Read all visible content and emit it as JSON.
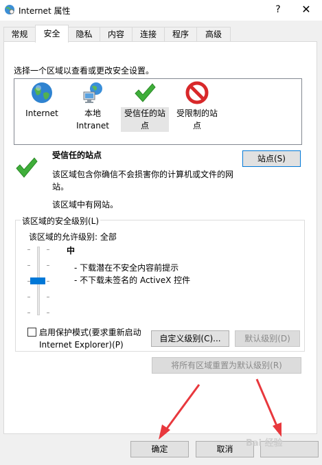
{
  "window": {
    "title": "Internet 属性",
    "help": "?",
    "close": "✕"
  },
  "tabs": [
    {
      "label": "常规"
    },
    {
      "label": "安全"
    },
    {
      "label": "隐私"
    },
    {
      "label": "内容"
    },
    {
      "label": "连接"
    },
    {
      "label": "程序"
    },
    {
      "label": "高级"
    }
  ],
  "active_tab": "安全",
  "zones": {
    "instruction": "选择一个区域以查看或更改安全设置。",
    "items": [
      {
        "label": "Internet",
        "icon": "globe-icon"
      },
      {
        "label": "本地 Intranet",
        "icon": "intranet-icon"
      },
      {
        "label": "受信任的站点",
        "icon": "checkmark-icon",
        "selected": true
      },
      {
        "label": "受限制的站点",
        "icon": "prohibited-icon"
      }
    ]
  },
  "zone_detail": {
    "title": "受信任的站点",
    "description": "该区域包含你确信不会损害你的计算机或文件的网站。",
    "note": "该区域中有网站。",
    "sites_button": "站点(S)"
  },
  "security_level": {
    "group_label": "该区域的安全级别(L)",
    "allowed_levels": "该区域的允许级别: 全部",
    "level_name": "中",
    "items": [
      "- 下载潜在不安全内容前提示",
      "- 不下载未签名的 ActiveX 控件"
    ],
    "protected_mode": "启用保护模式(要求重新启动 Internet Explorer)(P)",
    "protected_mode_checked": false,
    "custom_level_button": "自定义级别(C)...",
    "default_level_button": "默认级别(D)",
    "reset_all_button": "将所有区域重置为默认级别(R)"
  },
  "footer": {
    "ok": "确定",
    "cancel": "取消"
  },
  "watermark": "Bai 经验",
  "colors": {
    "accent": "#0078d7",
    "arrow": "#e8383d"
  }
}
